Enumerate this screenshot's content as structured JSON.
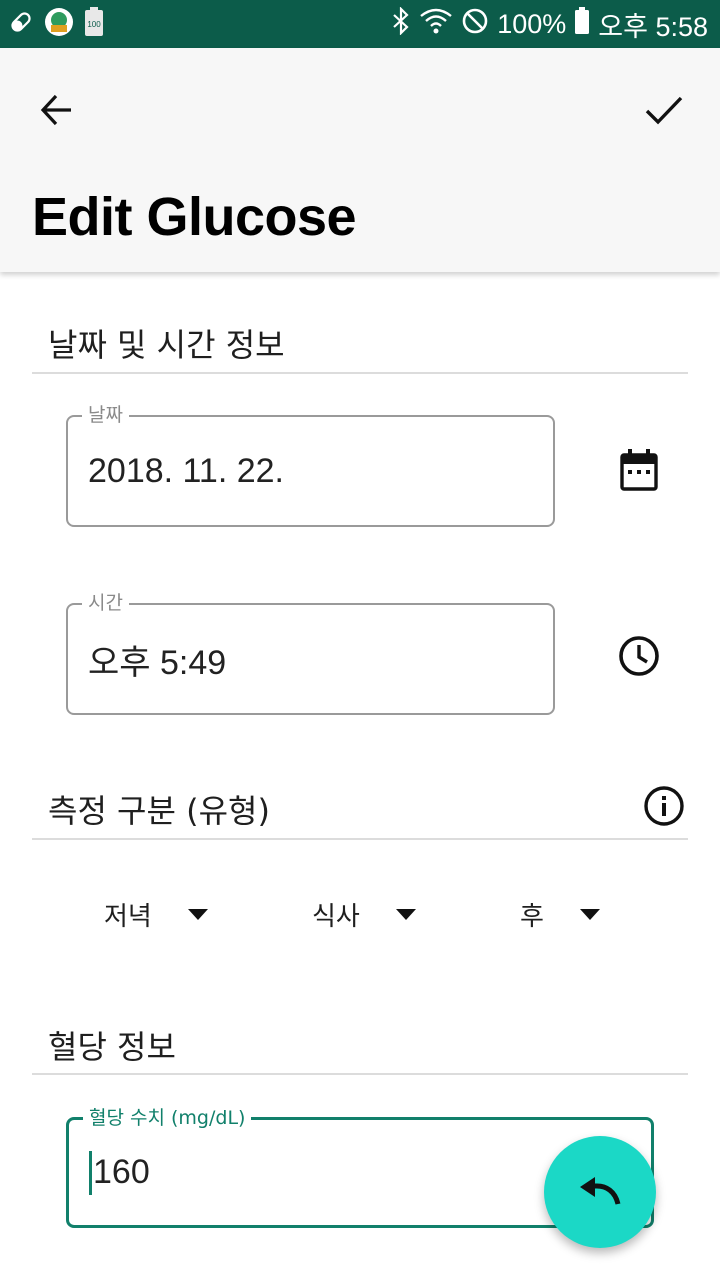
{
  "status_bar": {
    "left_icons": [
      "pill-icon",
      "app-badge-icon",
      "battery-100-notification-icon"
    ],
    "right_icons": [
      "bluetooth-icon",
      "wifi-icon",
      "do-not-disturb-icon",
      "battery-icon"
    ],
    "battery": "100%",
    "time": "오후 5:58"
  },
  "app_bar": {
    "title": "Edit Glucose",
    "back_icon": "arrow-back-icon",
    "confirm_icon": "check-icon"
  },
  "datetime_section": {
    "title": "날짜 및 시간 정보",
    "date_label": "날짜",
    "date_value": "2018. 11. 22.",
    "date_icon": "calendar-icon",
    "time_label": "시간",
    "time_value": "오후 5:49",
    "time_icon": "clock-icon"
  },
  "category_section": {
    "title": "측정 구분 (유형)",
    "info_icon": "info-icon",
    "dropdowns": [
      {
        "label": "저녁"
      },
      {
        "label": "식사"
      },
      {
        "label": "후"
      }
    ]
  },
  "glucose_section": {
    "title": "혈당 정보",
    "value_label": "혈당 수치 (mg/dL)",
    "value": "160"
  },
  "fab": {
    "icon": "undo-icon"
  },
  "colors": {
    "status_bar": "#0c5c4a",
    "accent": "#11806b",
    "fab": "#1bd8c6"
  }
}
